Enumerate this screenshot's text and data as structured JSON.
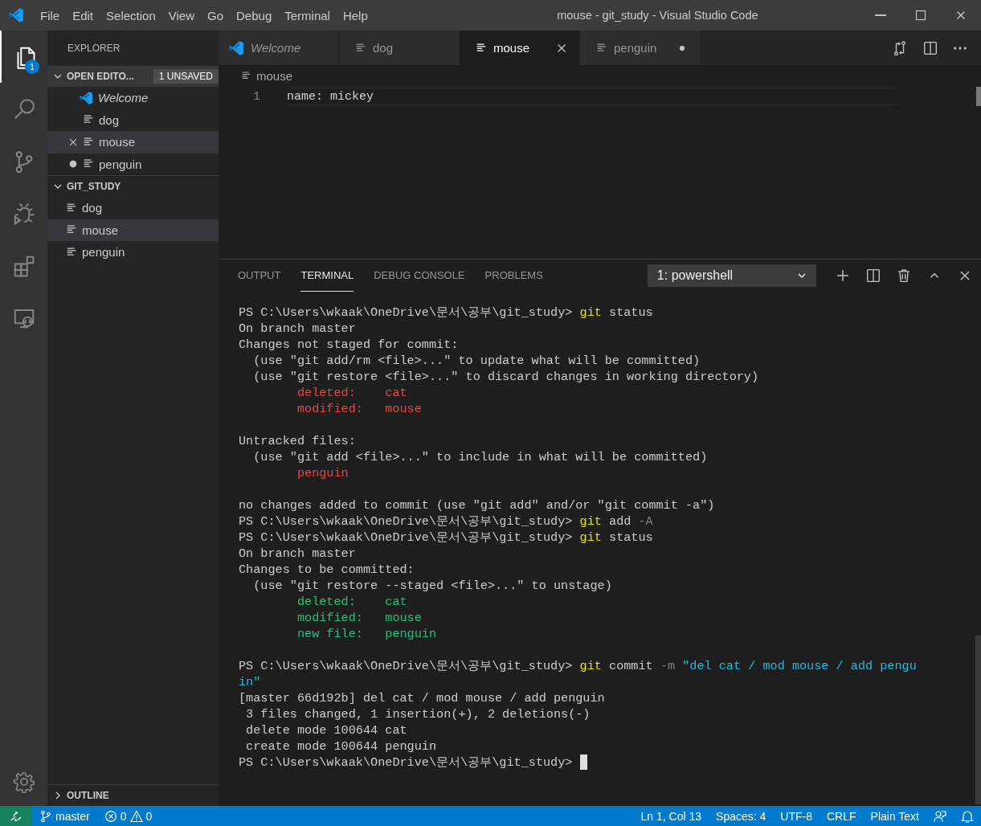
{
  "window": {
    "title": "mouse - git_study - Visual Studio Code"
  },
  "menu": [
    "File",
    "Edit",
    "Selection",
    "View",
    "Go",
    "Debug",
    "Terminal",
    "Help"
  ],
  "activity_bar": [
    {
      "kind": "explorer",
      "selected": true,
      "badge": "1"
    },
    {
      "kind": "search",
      "selected": false
    },
    {
      "kind": "scm",
      "selected": false
    },
    {
      "kind": "debug",
      "selected": false
    },
    {
      "kind": "extensions",
      "selected": false
    },
    {
      "kind": "remote",
      "selected": false
    }
  ],
  "sidebar": {
    "title": "EXPLORER",
    "sections": [
      {
        "kind": "open_editors",
        "title": "OPEN EDITO...",
        "badge": "1 UNSAVED",
        "expanded": true,
        "items": [
          {
            "label": "Welcome",
            "kind": "vscode",
            "preview": true,
            "selected": false,
            "dirty": false
          },
          {
            "label": "dog",
            "kind": "file",
            "preview": false,
            "selected": false,
            "dirty": false
          },
          {
            "label": "mouse",
            "kind": "file",
            "preview": false,
            "selected": true,
            "dirty": false
          },
          {
            "label": "penguin",
            "kind": "file",
            "preview": false,
            "selected": false,
            "dirty": true
          }
        ]
      },
      {
        "kind": "folder",
        "title": "GIT_STUDY",
        "expanded": true,
        "items": [
          {
            "label": "dog",
            "kind": "file",
            "selected": false
          },
          {
            "label": "mouse",
            "kind": "file",
            "selected": true
          },
          {
            "label": "penguin",
            "kind": "file",
            "selected": false
          }
        ]
      },
      {
        "kind": "outline",
        "title": "OUTLINE",
        "expanded": false
      }
    ]
  },
  "tabs": [
    {
      "label": "Welcome",
      "kind": "vscode",
      "preview": true,
      "selected": false,
      "dirty": false
    },
    {
      "label": "dog",
      "kind": "file",
      "preview": false,
      "selected": false,
      "dirty": false
    },
    {
      "label": "mouse",
      "kind": "file",
      "preview": false,
      "selected": true,
      "dirty": false
    },
    {
      "label": "penguin",
      "kind": "file",
      "preview": false,
      "selected": false,
      "dirty": true
    }
  ],
  "breadcrumb": "mouse",
  "editor_lines": [
    {
      "number": "1",
      "text": "name: mickey"
    }
  ],
  "panel": {
    "tabs": [
      {
        "label": "OUTPUT",
        "selected": false
      },
      {
        "label": "TERMINAL",
        "selected": true
      },
      {
        "label": "DEBUG CONSOLE",
        "selected": false
      },
      {
        "label": "PROBLEMS",
        "selected": false
      }
    ],
    "terminal_select": "1: powershell",
    "lines": [
      {
        "space_before": false,
        "segments": [
          {
            "kind": "plain",
            "text": "PS C:\\Users\\wkaak\\OneDrive\\문서\\공부\\git_study> "
          },
          {
            "kind": "command",
            "text": "git"
          },
          {
            "kind": "plain",
            "text": " status"
          }
        ]
      },
      {
        "space_before": false,
        "segments": [
          {
            "kind": "plain",
            "text": "On branch master"
          }
        ]
      },
      {
        "space_before": false,
        "segments": [
          {
            "kind": "plain",
            "text": "Changes not staged for commit:"
          }
        ]
      },
      {
        "space_before": false,
        "segments": [
          {
            "kind": "plain",
            "text": "  (use \"git add/rm <file>...\" to update what will be committed)"
          }
        ]
      },
      {
        "space_before": false,
        "segments": [
          {
            "kind": "plain",
            "text": "  (use \"git restore <file>...\" to discard changes in working directory)"
          }
        ]
      },
      {
        "space_before": false,
        "segments": [
          {
            "kind": "red",
            "text": "        deleted:    cat"
          }
        ]
      },
      {
        "space_before": false,
        "segments": [
          {
            "kind": "red",
            "text": "        modified:   mouse"
          }
        ]
      },
      {
        "space_before": true,
        "segments": [
          {
            "kind": "plain",
            "text": "Untracked files:"
          }
        ]
      },
      {
        "space_before": false,
        "segments": [
          {
            "kind": "plain",
            "text": "  (use \"git add <file>...\" to include in what will be committed)"
          }
        ]
      },
      {
        "space_before": false,
        "segments": [
          {
            "kind": "red",
            "text": "        penguin"
          }
        ]
      },
      {
        "space_before": true,
        "segments": [
          {
            "kind": "plain",
            "text": "no changes added to commit (use \"git add\" and/or \"git commit -a\")"
          }
        ]
      },
      {
        "space_before": false,
        "segments": [
          {
            "kind": "plain",
            "text": "PS C:\\Users\\wkaak\\OneDrive\\문서\\공부\\git_study> "
          },
          {
            "kind": "command",
            "text": "git"
          },
          {
            "kind": "plain",
            "text": " add "
          },
          {
            "kind": "flag",
            "text": "-A"
          }
        ]
      },
      {
        "space_before": false,
        "segments": [
          {
            "kind": "plain",
            "text": "PS C:\\Users\\wkaak\\OneDrive\\문서\\공부\\git_study> "
          },
          {
            "kind": "command",
            "text": "git"
          },
          {
            "kind": "plain",
            "text": " status"
          }
        ]
      },
      {
        "space_before": false,
        "segments": [
          {
            "kind": "plain",
            "text": "On branch master"
          }
        ]
      },
      {
        "space_before": false,
        "segments": [
          {
            "kind": "plain",
            "text": "Changes to be committed:"
          }
        ]
      },
      {
        "space_before": false,
        "segments": [
          {
            "kind": "plain",
            "text": "  (use \"git restore --staged <file>...\" to unstage)"
          }
        ]
      },
      {
        "space_before": false,
        "segments": [
          {
            "kind": "green",
            "text": "        deleted:    cat"
          }
        ]
      },
      {
        "space_before": false,
        "segments": [
          {
            "kind": "green",
            "text": "        modified:   mouse"
          }
        ]
      },
      {
        "space_before": false,
        "segments": [
          {
            "kind": "green",
            "text": "        new file:   penguin"
          }
        ]
      },
      {
        "space_before": true,
        "segments": [
          {
            "kind": "plain",
            "text": "PS C:\\Users\\wkaak\\OneDrive\\문서\\공부\\git_study> "
          },
          {
            "kind": "command",
            "text": "git"
          },
          {
            "kind": "plain",
            "text": " commit "
          },
          {
            "kind": "flag",
            "text": "-m"
          },
          {
            "kind": "string",
            "text": " \"del cat / mod mouse / add pengu"
          }
        ]
      },
      {
        "space_before": false,
        "segments": [
          {
            "kind": "string",
            "text": "in\""
          }
        ]
      },
      {
        "space_before": false,
        "segments": [
          {
            "kind": "plain",
            "text": "[master 66d192b] del cat / mod mouse / add penguin"
          }
        ]
      },
      {
        "space_before": false,
        "segments": [
          {
            "kind": "plain",
            "text": " 3 files changed, 1 insertion(+), 2 deletions(-)"
          }
        ]
      },
      {
        "space_before": false,
        "segments": [
          {
            "kind": "plain",
            "text": " delete mode 100644 cat"
          }
        ]
      },
      {
        "space_before": false,
        "segments": [
          {
            "kind": "plain",
            "text": " create mode 100644 penguin"
          }
        ]
      },
      {
        "space_before": false,
        "cursor": true,
        "segments": [
          {
            "kind": "plain",
            "text": "PS C:\\Users\\wkaak\\OneDrive\\문서\\공부\\git_study> "
          }
        ]
      }
    ]
  },
  "status_bar": {
    "branch": "master",
    "errors": "0",
    "warnings": "0",
    "items": [
      "Ln 1, Col 13",
      "Spaces: 4",
      "UTF-8",
      "CRLF",
      "Plain Text"
    ]
  }
}
